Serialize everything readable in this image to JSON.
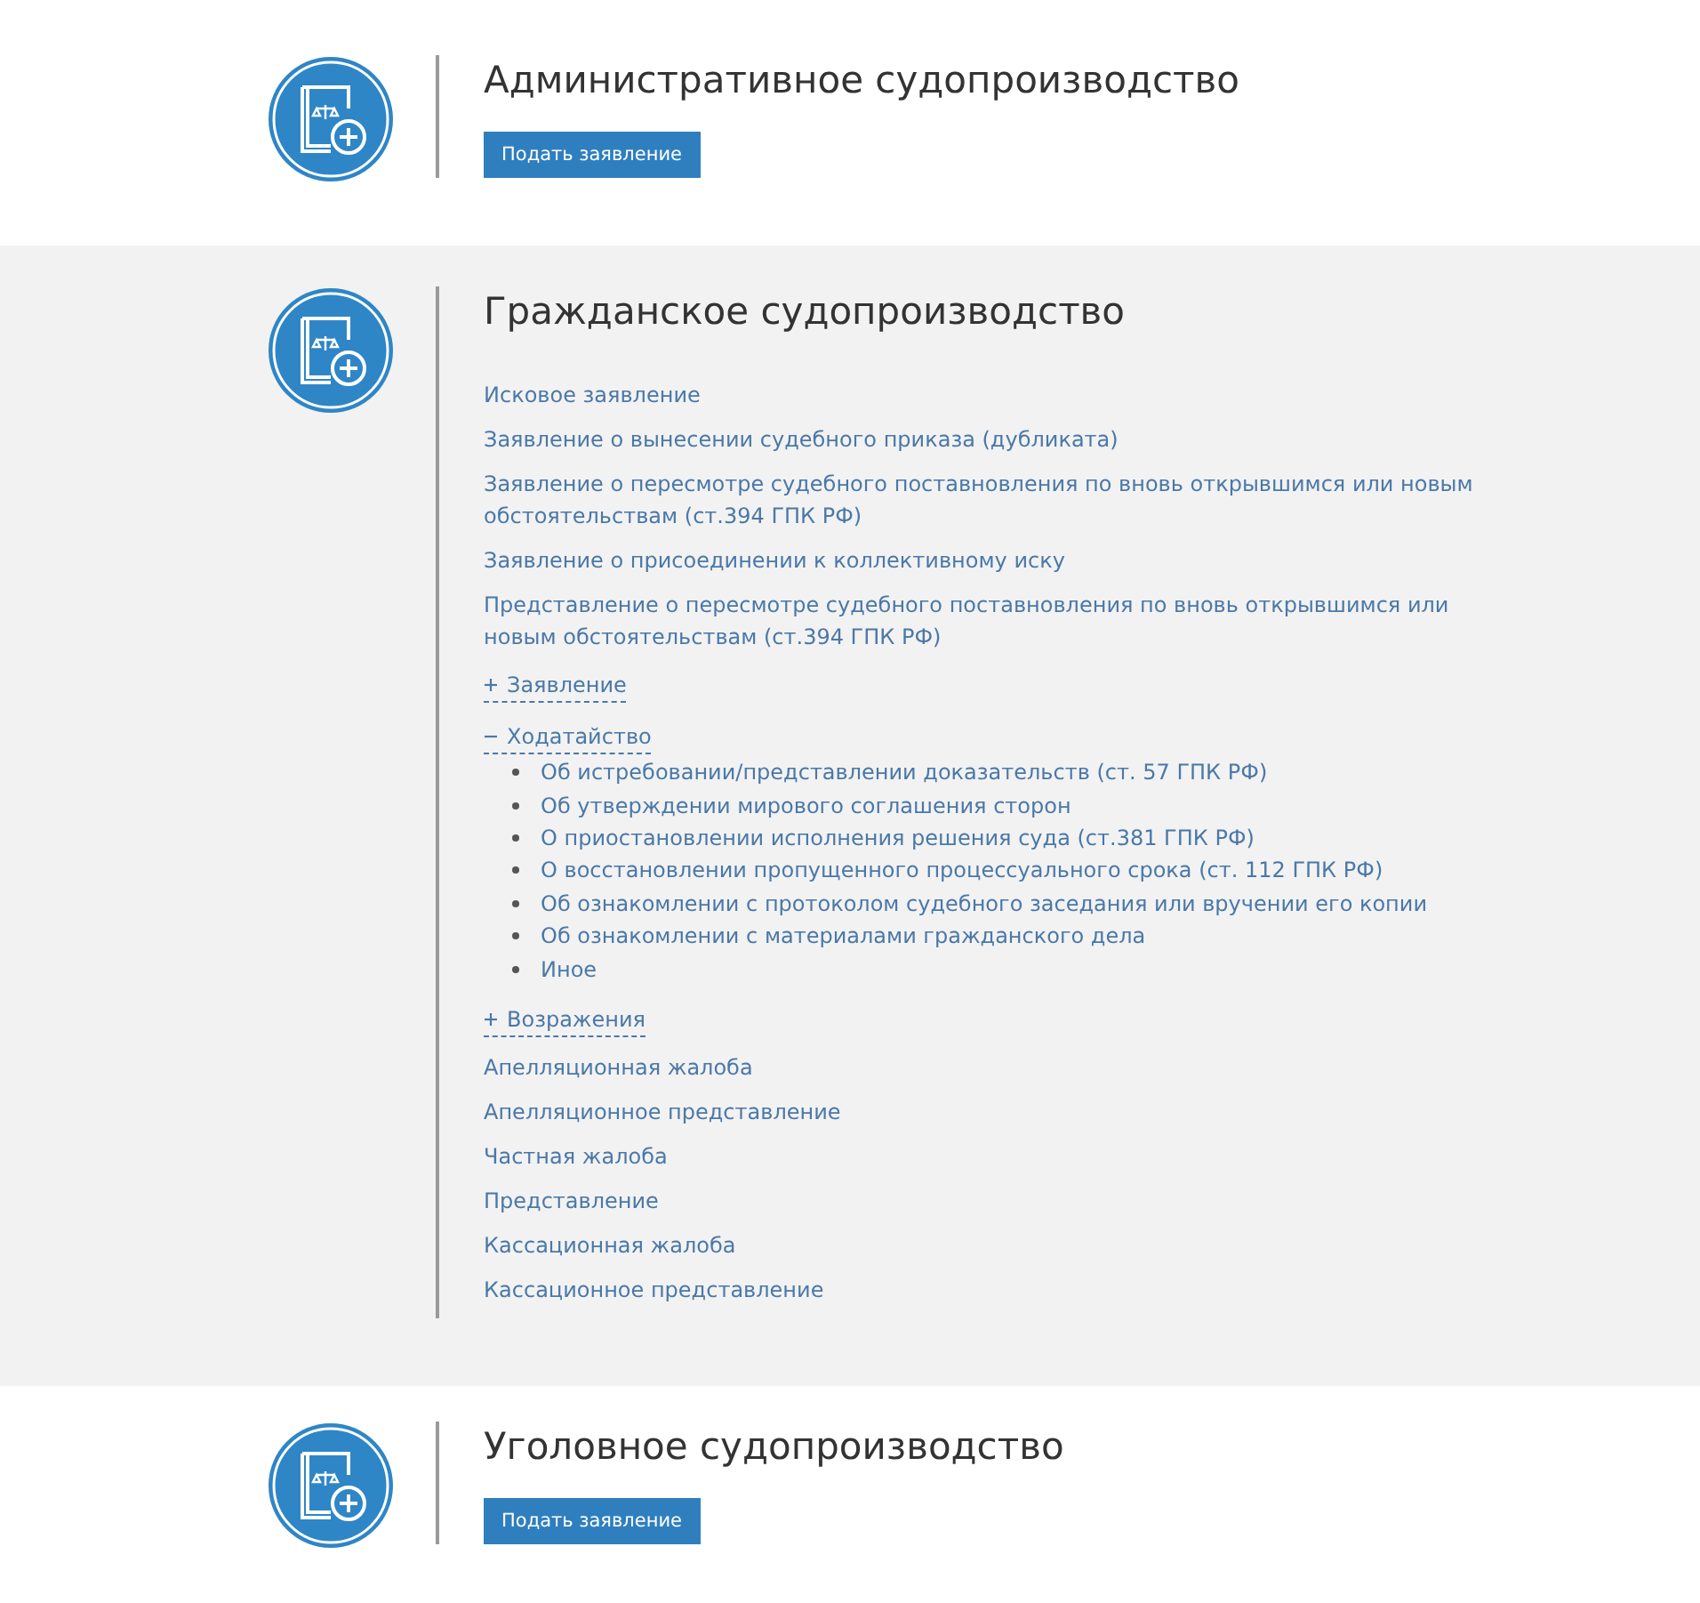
{
  "sections": [
    {
      "title": "Административное судопроизводство",
      "expanded": false,
      "button": "Подать заявление"
    },
    {
      "title": "Гражданское судопроизводство",
      "expanded": true,
      "items": [
        {
          "kind": "link",
          "text": "Исковое заявление"
        },
        {
          "kind": "link",
          "text": "Заявление о вынесении судебного приказа (дубликата)"
        },
        {
          "kind": "link",
          "text": "Заявление о пересмотре судебного поставновления по вновь открывшимся или новым обстоятельствам (ст.394 ГПК РФ)"
        },
        {
          "kind": "link",
          "text": "Заявление о присоединении к коллективному иску"
        },
        {
          "kind": "link",
          "text": "Представление о пересмотре судебного поставновления по вновь открывшимся или новым обстоятельствам (ст.394 ГПК РФ)"
        },
        {
          "kind": "toggle",
          "text": "Заявление",
          "expanded": false
        },
        {
          "kind": "toggle",
          "text": "Ходатайство",
          "expanded": true,
          "children": [
            "Об истребовании/представлении доказательств (ст. 57 ГПК РФ)",
            "Об утверждении мирового соглашения сторон",
            "О приостановлении исполнения решения суда (ст.381 ГПК РФ)",
            "О восстановлении пропущенного процессуального срока (ст. 112 ГПК РФ)",
            "Об ознакомлении с протоколом судебного заседания или вручении его копии",
            "Об ознакомлении с материалами гражданского дела",
            "Иное"
          ]
        },
        {
          "kind": "toggle",
          "text": "Возражения",
          "expanded": false
        },
        {
          "kind": "link",
          "text": "Апелляционная жалоба"
        },
        {
          "kind": "link",
          "text": "Апелляционное представление"
        },
        {
          "kind": "link",
          "text": "Частная жалоба"
        },
        {
          "kind": "link",
          "text": "Представление"
        },
        {
          "kind": "link",
          "text": "Кассационная жалоба"
        },
        {
          "kind": "link",
          "text": "Кассационное представление"
        }
      ]
    },
    {
      "title": "Уголовное судопроизводство",
      "expanded": false,
      "button": "Подать заявление"
    }
  ]
}
